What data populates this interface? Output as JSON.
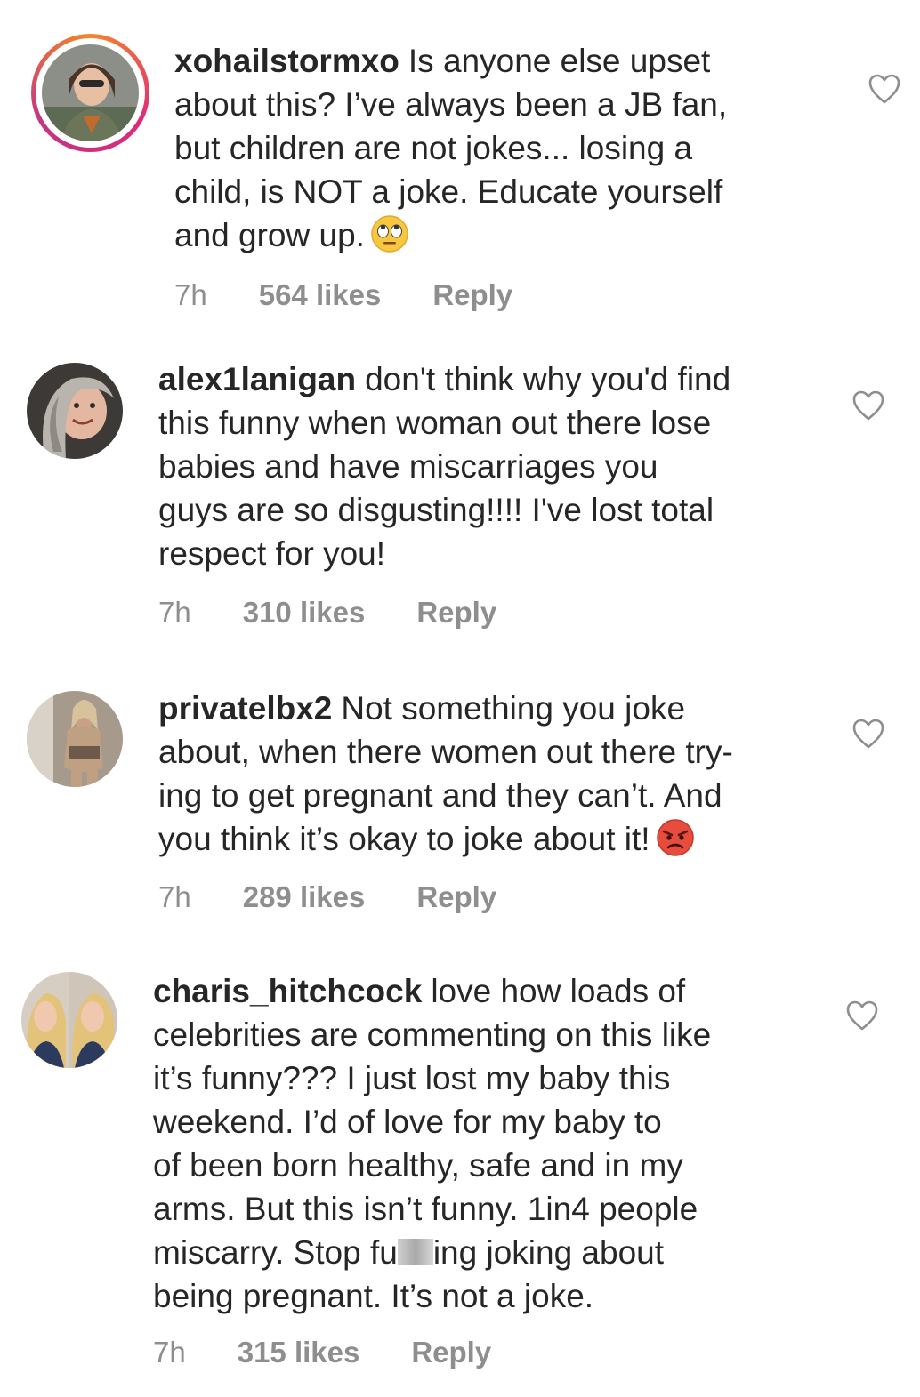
{
  "comments": [
    {
      "username": "xohailstormxo",
      "text_lines": [
        "Is anyone else upset",
        "about this? I’ve always been a JB fan,",
        "but children are not jokes... losing a",
        "child, is NOT a joke. Educate yourself",
        "and grow up."
      ],
      "emoji": "face-with-rolling-eyes",
      "time": "7h",
      "likes": "564 likes",
      "reply": "Reply",
      "has_story_ring": true
    },
    {
      "username": "alex1lanigan",
      "text_lines": [
        "don't think why you'd find",
        "this funny when woman out there lose",
        "babies and have miscarriages you",
        "guys are so disgusting!!!! I've lost total",
        "respect for you!"
      ],
      "time": "7h",
      "likes": "310 likes",
      "reply": "Reply",
      "has_story_ring": false
    },
    {
      "username": "privatelbx2",
      "text_lines": [
        "Not something you joke",
        "about, when there women out there try-",
        "ing to get pregnant and they can’t. And",
        "you think it’s okay to joke about it!"
      ],
      "emoji": "angry-face",
      "time": "7h",
      "likes": "289 likes",
      "reply": "Reply",
      "has_story_ring": false
    },
    {
      "username": "charis_hitchcock",
      "text_lines": [
        "love how loads of",
        "celebrities are commenting on this like",
        "it’s funny??? I just lost my baby this",
        "weekend. I’d of love for my baby to",
        "of been born healthy, safe and in my",
        "arms. But this isn’t funny. 1in4 people",
        "miscarry. Stop fu",
        "ing joking about",
        "being pregnant. It’s not a joke."
      ],
      "time": "7h",
      "likes": "315 likes",
      "reply": "Reply",
      "has_story_ring": false
    }
  ],
  "icons": {
    "heart": "heart-outline-icon"
  },
  "colors": {
    "text": "#262626",
    "meta": "#8e8e8e",
    "story_ring_start": "#f58529",
    "story_ring_end": "#dd2a7b"
  }
}
